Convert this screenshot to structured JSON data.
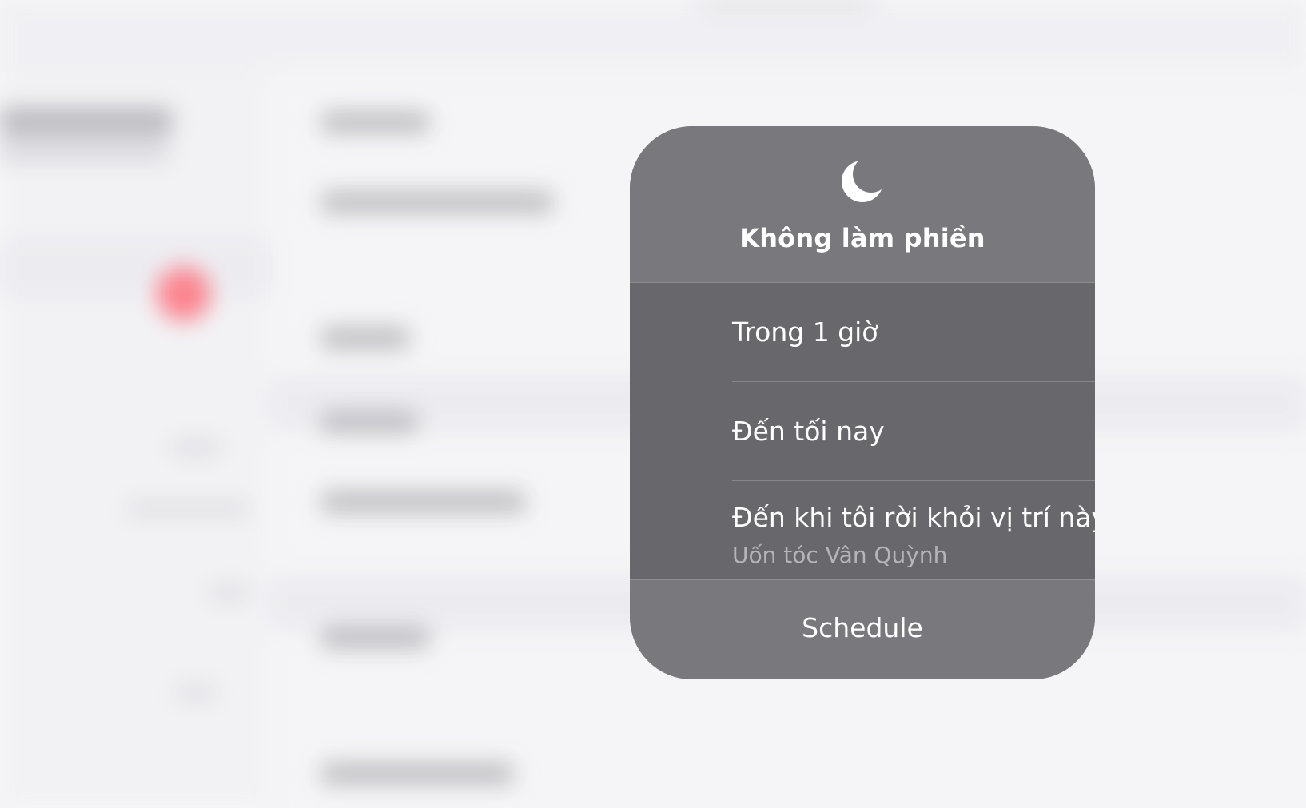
{
  "dnd_menu": {
    "icon": "moon-icon",
    "title": "Không làm phiền",
    "options": [
      {
        "label": "Trong 1 giờ"
      },
      {
        "label": "Đến tối nay"
      },
      {
        "label": "Đến khi tôi rời khỏi vị trí này",
        "sublabel": "Uốn tóc Vân Quỳnh"
      }
    ],
    "schedule_label": "Schedule"
  },
  "colors": {
    "card_background": "#76767a",
    "options_background": "#68686c",
    "text_primary": "#ffffff",
    "text_secondary": "#b5b5b9",
    "background_badge": "#ff4f5e"
  }
}
